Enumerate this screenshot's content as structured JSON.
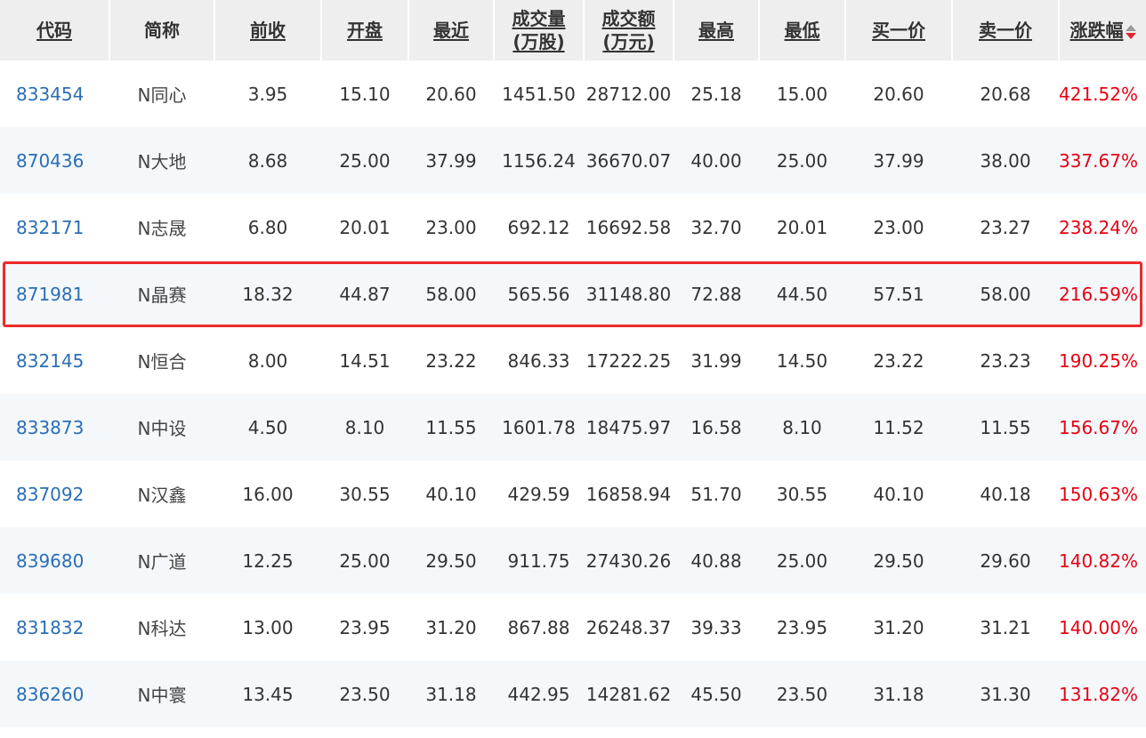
{
  "table": {
    "headers": [
      {
        "label": "代码",
        "line2": ""
      },
      {
        "label": "简称",
        "line2": ""
      },
      {
        "label": "前收",
        "line2": ""
      },
      {
        "label": "开盘",
        "line2": ""
      },
      {
        "label": "最近",
        "line2": ""
      },
      {
        "label": "成交量",
        "line2": "(万股)"
      },
      {
        "label": "成交额",
        "line2": "(万元)"
      },
      {
        "label": "最高",
        "line2": ""
      },
      {
        "label": "最低",
        "line2": ""
      },
      {
        "label": "买一价",
        "line2": ""
      },
      {
        "label": "卖一价",
        "line2": ""
      },
      {
        "label": "涨跌幅",
        "line2": ""
      }
    ],
    "rows": [
      [
        "833454",
        "N同心",
        "3.95",
        "15.10",
        "20.60",
        "1451.50",
        "28712.00",
        "25.18",
        "15.00",
        "20.60",
        "20.68",
        "421.52%"
      ],
      [
        "870436",
        "N大地",
        "8.68",
        "25.00",
        "37.99",
        "1156.24",
        "36670.07",
        "40.00",
        "25.00",
        "37.99",
        "38.00",
        "337.67%"
      ],
      [
        "832171",
        "N志晟",
        "6.80",
        "20.01",
        "23.00",
        "692.12",
        "16692.58",
        "32.70",
        "20.01",
        "23.00",
        "23.27",
        "238.24%"
      ],
      [
        "871981",
        "N晶赛",
        "18.32",
        "44.87",
        "58.00",
        "565.56",
        "31148.80",
        "72.88",
        "44.50",
        "57.51",
        "58.00",
        "216.59%"
      ],
      [
        "832145",
        "N恒合",
        "8.00",
        "14.51",
        "23.22",
        "846.33",
        "17222.25",
        "31.99",
        "14.50",
        "23.22",
        "23.23",
        "190.25%"
      ],
      [
        "833873",
        "N中设",
        "4.50",
        "8.10",
        "11.55",
        "1601.78",
        "18475.97",
        "16.58",
        "8.10",
        "11.52",
        "11.55",
        "156.67%"
      ],
      [
        "837092",
        "N汉鑫",
        "16.00",
        "30.55",
        "40.10",
        "429.59",
        "16858.94",
        "51.70",
        "30.55",
        "40.10",
        "40.18",
        "150.63%"
      ],
      [
        "839680",
        "N广道",
        "12.25",
        "25.00",
        "29.50",
        "911.75",
        "27430.26",
        "40.88",
        "25.00",
        "29.50",
        "29.60",
        "140.82%"
      ],
      [
        "831832",
        "N科达",
        "13.00",
        "23.95",
        "31.20",
        "867.88",
        "26248.37",
        "39.33",
        "23.95",
        "31.20",
        "31.21",
        "140.00%"
      ],
      [
        "836260",
        "N中寰",
        "13.45",
        "23.50",
        "31.18",
        "442.95",
        "14281.62",
        "45.50",
        "23.50",
        "31.18",
        "31.30",
        "131.82%"
      ]
    ],
    "highlighted_row": 3,
    "sort_column": 11,
    "sort_direction": "desc"
  },
  "colors": {
    "code_link": "#2a6eb5",
    "change_up": "#e60012",
    "highlight_border": "#ef2a2a",
    "header_bg": "#eeeeee",
    "stripe_bg": "#f4f8fb"
  }
}
